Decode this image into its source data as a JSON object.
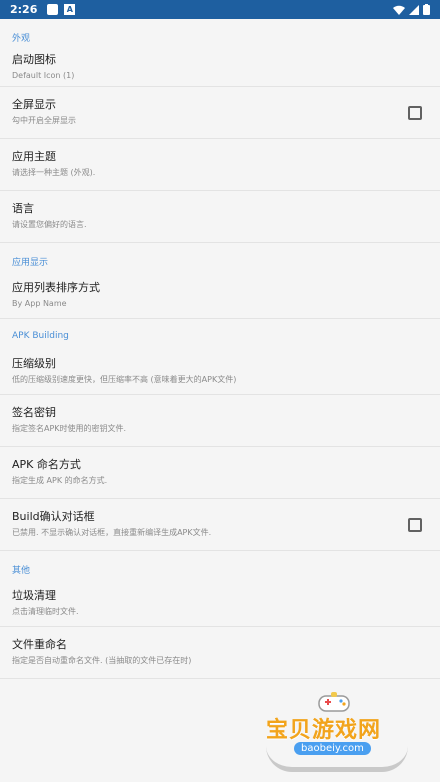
{
  "statusbar": {
    "time": "2:26"
  },
  "sections": [
    {
      "header": "外观",
      "items": [
        {
          "title": "启动图标",
          "summary": "Default Icon (1)",
          "checkbox": false
        }
      ]
    },
    {
      "header": "",
      "items": [
        {
          "title": "全屏显示",
          "summary": "勾中开启全屏显示",
          "checkbox": true
        },
        {
          "title": "应用主题",
          "summary": "请选择一种主题 (外观).",
          "checkbox": false
        },
        {
          "title": "语言",
          "summary": "请设置您偏好的语言.",
          "checkbox": false
        }
      ]
    },
    {
      "header": "应用显示",
      "items": [
        {
          "title": "应用列表排序方式",
          "summary": "By App Name",
          "checkbox": false
        }
      ]
    },
    {
      "header": "APK Building",
      "items": [
        {
          "title": "压缩级别",
          "summary": "低的压缩级别速度更快，但压缩率不高 (意味着更大的APK文件)",
          "checkbox": false
        },
        {
          "title": "签名密钥",
          "summary": "指定签名APK时使用的密钥文件.",
          "checkbox": false
        },
        {
          "title": "APK 命名方式",
          "summary": "指定生成 APK 的命名方式.",
          "checkbox": false
        },
        {
          "title": "Build确认对话框",
          "summary": "已禁用. 不显示确认对话框，直接重新编译生成APK文件.",
          "checkbox": true
        }
      ]
    },
    {
      "header": "其他",
      "items": [
        {
          "title": "垃圾清理",
          "summary": "点击清理临时文件.",
          "checkbox": false
        },
        {
          "title": "文件重命名",
          "summary": "指定是否自动重命名文件. (当抽取的文件已存在时)",
          "checkbox": false
        }
      ]
    }
  ],
  "watermark": {
    "text": "宝贝游戏网",
    "url": "baobeiy.com"
  }
}
